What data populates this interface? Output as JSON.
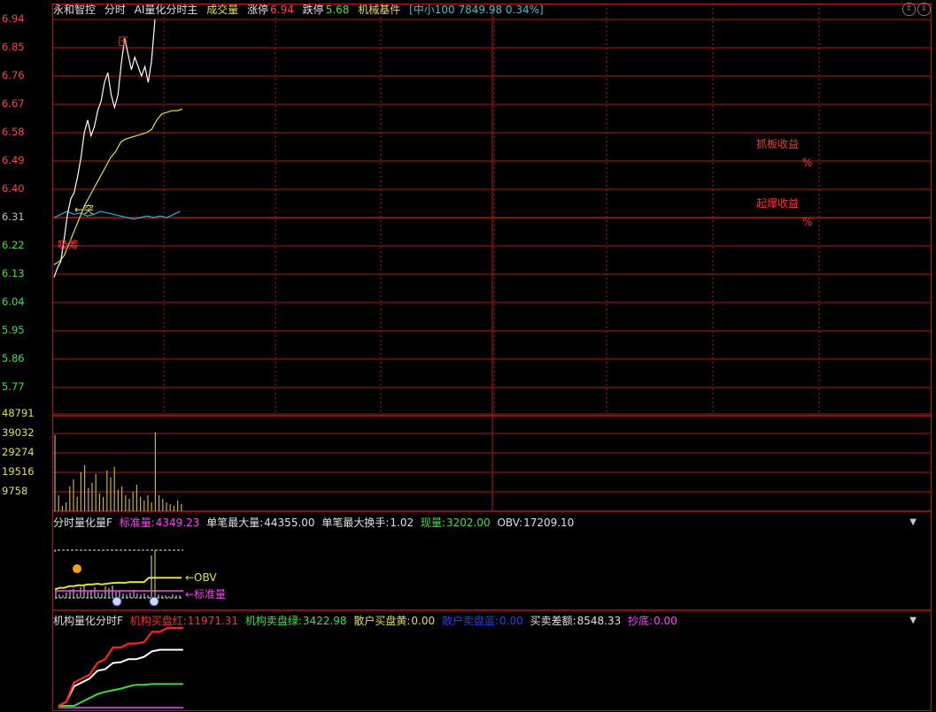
{
  "header": {
    "stock_name": "永和智控",
    "view": "分时",
    "indicator": "AI量化分时主",
    "volume_label": "成交量",
    "limit_up_label": "涨停",
    "limit_up_value": "6.94",
    "limit_down_label": "跌停",
    "limit_down_value": "5.68",
    "sector": "机械基件",
    "index_info": "[中小100 7849.98 0.34%]"
  },
  "window_buttons": {
    "up": "⇧",
    "down": "⇩"
  },
  "price_axis": [
    "6.94",
    "6.85",
    "6.76",
    "6.67",
    "6.58",
    "6.49",
    "6.40",
    "6.31",
    "6.22",
    "6.13",
    "6.04",
    "5.95",
    "5.86",
    "5.77"
  ],
  "volume_axis": [
    "48791",
    "39032",
    "29274",
    "19516",
    "9758"
  ],
  "annotations": {
    "pressure": "压",
    "support": "吸筹",
    "breakout": "←突",
    "grab_limit_return": "抓板收益",
    "grab_limit_pct": "%",
    "start_return": "起爆收益",
    "start_pct": "%"
  },
  "panel2": {
    "name": "分时量化量F",
    "std_label": "标准量:",
    "std_value": "4349.23",
    "max_vol_label": "单笔最大量:",
    "max_vol_value": "44355.00",
    "max_turn_label": "单笔最大换手:",
    "max_turn_value": "1.02",
    "cur_label": "现量:",
    "cur_value": "3202.00",
    "obv_label": "OBV:",
    "obv_value": "17209.10",
    "obv_tag": "←OBV",
    "std_tag": "←标准量"
  },
  "panel3": {
    "name": "机构量化分时F",
    "buy_label": "机构买盘红:",
    "buy_value": "11971.31",
    "sell_label": "机构卖盘绿:",
    "sell_value": "3422.98",
    "retail_buy_label": "散户买盘黄:",
    "retail_buy_value": "0.00",
    "retail_sell_label": "散户卖盘蓝:",
    "retail_sell_value": "0.00",
    "diff_label": "买卖差额:",
    "diff_value": "8548.33",
    "bottom_label": "抄底:",
    "bottom_value": "0.00"
  },
  "chart_data": {
    "type": "line",
    "price_range": [
      5.68,
      6.94
    ],
    "reference_price": 6.31,
    "volume_range": [
      0,
      48791
    ],
    "series": [
      {
        "name": "price",
        "values": [
          6.12,
          6.15,
          6.17,
          6.24,
          6.32,
          6.37,
          6.39,
          6.44,
          6.5,
          6.58,
          6.62,
          6.57,
          6.6,
          6.65,
          6.68,
          6.74,
          6.77,
          6.7,
          6.66,
          6.7,
          6.8,
          6.88,
          6.83,
          6.78,
          6.82,
          6.79,
          6.76,
          6.79,
          6.74,
          6.81,
          6.94
        ]
      },
      {
        "name": "avg",
        "values": [
          6.16,
          6.17,
          6.19,
          6.23,
          6.27,
          6.31,
          6.35,
          6.38,
          6.41,
          6.44,
          6.47,
          6.5,
          6.52,
          6.55,
          6.56,
          6.565,
          6.57,
          6.575,
          6.58,
          6.59,
          6.62,
          6.64,
          6.645,
          6.65,
          6.65,
          6.655
        ]
      },
      {
        "name": "index",
        "values": [
          6.31,
          6.32,
          6.33,
          6.32,
          6.325,
          6.315,
          6.32,
          6.33,
          6.325,
          6.32,
          6.315,
          6.31,
          6.305,
          6.31,
          6.315,
          6.31,
          6.315,
          6.31,
          6.32,
          6.33
        ]
      },
      {
        "name": "volume",
        "values": [
          43000,
          9000,
          3000,
          5000,
          14000,
          18000,
          8000,
          22000,
          26000,
          13000,
          16000,
          21000,
          10000,
          8000,
          23000,
          19000,
          25000,
          12000,
          14000,
          9000,
          7000,
          11000,
          15000,
          8000,
          6000,
          9000,
          5000,
          44355,
          9000,
          7000,
          5000,
          4000,
          3000,
          6000,
          4000
        ]
      },
      {
        "name": "obv",
        "values": [
          0.25,
          0.3,
          0.3,
          0.35,
          0.35,
          0.38,
          0.37,
          0.4,
          0.4,
          0.42,
          0.4,
          0.42,
          0.44,
          0.45,
          0.45,
          0.45,
          0.47,
          0.47,
          0.47,
          0.47,
          0.6,
          0.6,
          0.6,
          0.6,
          0.6,
          0.6,
          0.6,
          0.6
        ]
      },
      {
        "name": "inst_buy_red",
        "values": [
          0,
          0.05,
          0.3,
          0.35,
          0.4,
          0.55,
          0.6,
          0.75,
          0.75,
          0.8,
          0.8,
          0.82,
          0.95,
          0.95,
          1.0,
          1.0,
          1.0
        ]
      },
      {
        "name": "net_white",
        "values": [
          0,
          0.05,
          0.25,
          0.3,
          0.35,
          0.45,
          0.47,
          0.55,
          0.56,
          0.6,
          0.6,
          0.63,
          0.7,
          0.72,
          0.72,
          0.72,
          0.72
        ]
      },
      {
        "name": "inst_sell_green",
        "values": [
          0,
          0,
          0,
          0.05,
          0.1,
          0.15,
          0.18,
          0.2,
          0.22,
          0.25,
          0.27,
          0.27,
          0.28,
          0.28,
          0.28,
          0.28,
          0.28
        ]
      }
    ]
  }
}
